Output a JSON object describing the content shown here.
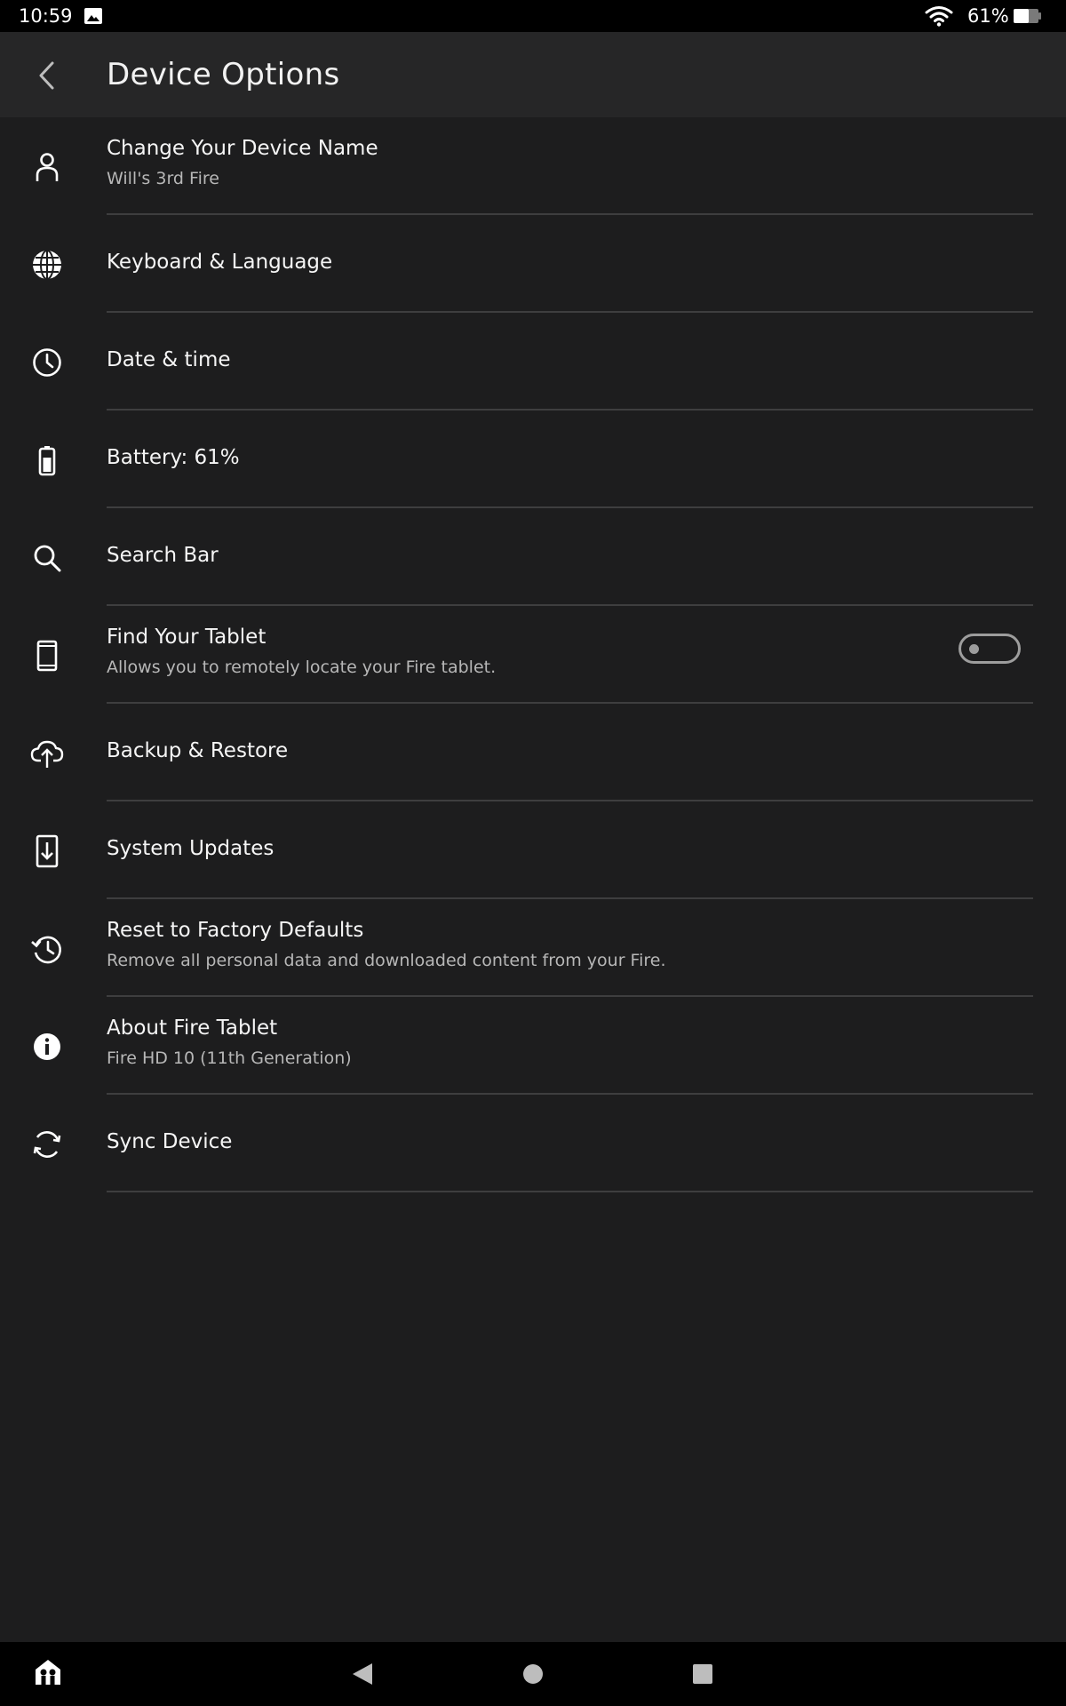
{
  "status_bar": {
    "time": "10:59",
    "battery_text": "61%",
    "icons": [
      "image-icon",
      "wifi-icon",
      "battery-icon"
    ]
  },
  "header": {
    "title": "Device Options",
    "back_icon": "chevron-left-icon"
  },
  "items": [
    {
      "title": "Change Your Device Name",
      "subtitle": "Will's 3rd Fire",
      "icon": "person-icon"
    },
    {
      "title": "Keyboard  & Language",
      "icon": "globe-icon"
    },
    {
      "title": "Date & time",
      "icon": "clock-icon"
    },
    {
      "title": "Battery: 61%",
      "icon": "battery-icon"
    },
    {
      "title": "Search Bar",
      "icon": "search-icon"
    },
    {
      "title": "Find Your Tablet",
      "subtitle": "Allows you to remotely locate your Fire tablet.",
      "icon": "tablet-icon",
      "toggle_on": false
    },
    {
      "title": "Backup & Restore",
      "icon": "cloud-upload-icon"
    },
    {
      "title": "System Updates",
      "icon": "system-update-icon"
    },
    {
      "title": "Reset to Factory Defaults",
      "subtitle": "Remove all personal data and downloaded content from your Fire.",
      "icon": "history-icon"
    },
    {
      "title": "About Fire Tablet",
      "subtitle": "Fire HD 10 (11th Generation)",
      "icon": "info-icon"
    },
    {
      "title": "Sync Device",
      "icon": "sync-icon"
    }
  ],
  "nav_bar": {
    "icons": [
      "kids-profile-icon",
      "nav-back-icon",
      "nav-home-icon",
      "nav-recents-icon"
    ]
  },
  "colors": {
    "background": "#1d1d1e",
    "header": "#262627",
    "divider": "#3e3e3f",
    "subtitle": "#b7b7b7"
  }
}
